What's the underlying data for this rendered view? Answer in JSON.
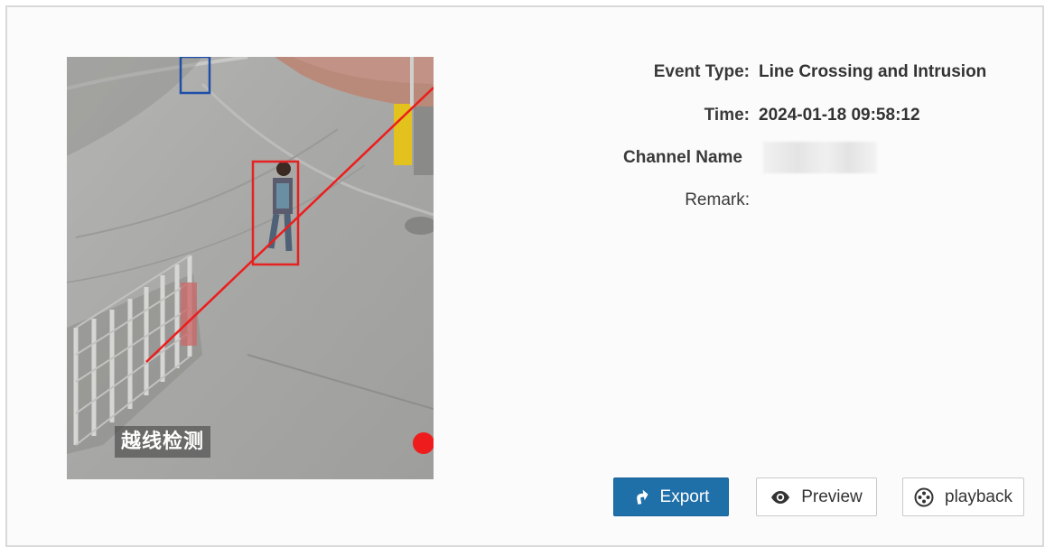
{
  "snapshot": {
    "caption": "越线检测"
  },
  "details": {
    "event_type": {
      "label": "Event Type:",
      "value": "Line Crossing and Intrusion"
    },
    "time": {
      "label": "Time:",
      "value": "2024-01-18 09:58:12"
    },
    "channel_name": {
      "label": "Channel Name",
      "value": ""
    },
    "remark": {
      "label": "Remark:",
      "value": ""
    }
  },
  "actions": {
    "export_label": "Export",
    "preview_label": "Preview",
    "playback_label": "playback"
  },
  "colors": {
    "primary_button": "#1f6fa8",
    "detection_box": "#e52222",
    "tripwire_line": "#ee1c1c",
    "secondary_box": "#1e4fa8"
  }
}
